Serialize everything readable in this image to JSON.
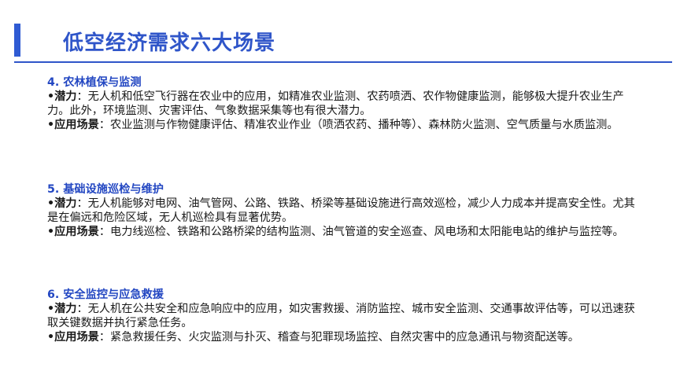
{
  "page": {
    "title": "低空经济需求六大场景"
  },
  "sections": [
    {
      "heading": "4. 农林植保与监测",
      "potential_label": "•潜力",
      "potential_text": "：无人机和低空飞行器在农业中的应用，如精准农业监测、农药喷洒、农作物健康监测，能够极大提升农业生产力。此外，环境监测、灾害评估、气象数据采集等也有很大潜力。",
      "app_label": "•应用场景",
      "app_text": "：农业监测与作物健康评估、精准农业作业（喷洒农药、播种等）、森林防火监测、空气质量与水质监测。"
    },
    {
      "heading": "5. 基础设施巡检与维护",
      "potential_label": "•潜力",
      "potential_text": "：无人机能够对电网、油气管网、公路、铁路、桥梁等基础设施进行高效巡检，减少人力成本并提高安全性。尤其是在偏远和危险区域，无人机巡检具有显著优势。",
      "app_label": "•应用场景",
      "app_text": "：电力线巡检、铁路和公路桥梁的结构监测、油气管道的安全巡查、风电场和太阳能电站的维护与监控等。"
    },
    {
      "heading": "6. 安全监控与应急救援",
      "potential_label": "•潜力",
      "potential_text": "：无人机在公共安全和应急响应中的应用，如灾害救援、消防监控、城市安全监测、交通事故评估等，可以迅速获取关键数据并执行紧急任务。",
      "app_label": "•应用场景",
      "app_text": "：紧急救援任务、火灾监测与扑灭、稽查与犯罪现场监控、自然灾害中的应急通讯与物资配送等。"
    }
  ]
}
